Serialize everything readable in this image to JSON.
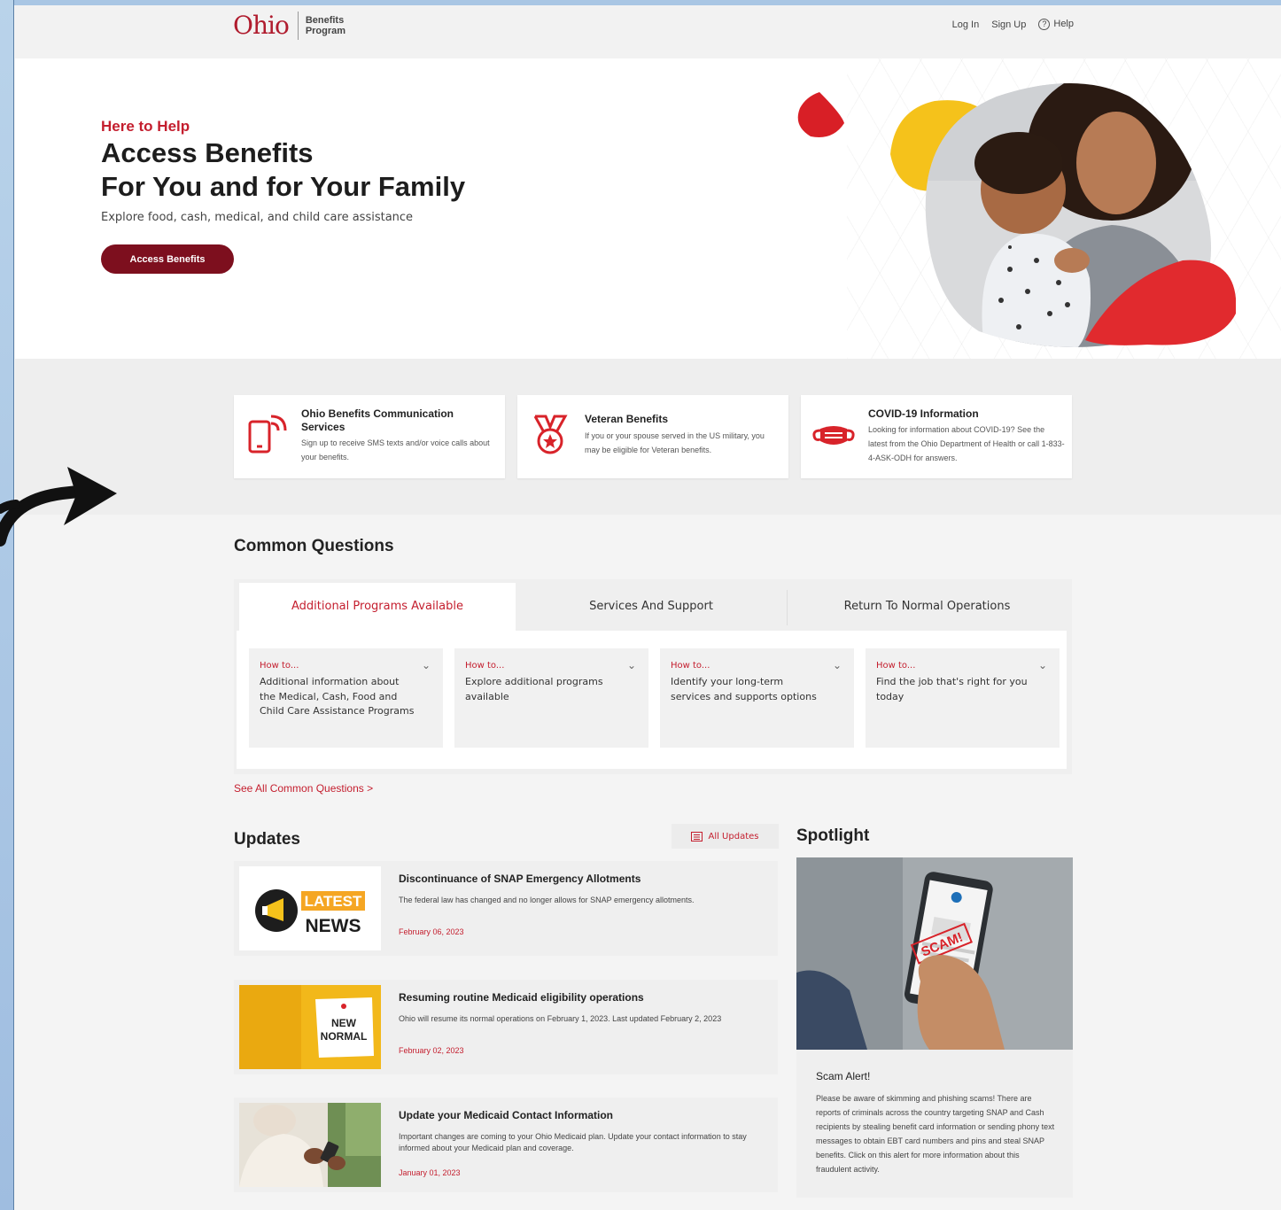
{
  "header": {
    "logo_word": "Ohio",
    "logo_sub_1": "Benefits",
    "logo_sub_2": "Program",
    "nav": {
      "login": "Log In",
      "signup": "Sign Up",
      "help": "Help"
    }
  },
  "hero": {
    "eyebrow": "Here to Help",
    "title_1": "Access Benefits",
    "title_2": "For You and for Your Family",
    "subtitle": "Explore food, cash, medical, and child care assistance",
    "button": "Access Benefits"
  },
  "info_cards": [
    {
      "title": "Ohio Benefits Communication Services",
      "desc": "Sign up to receive SMS texts and/or voice calls about your benefits.",
      "icon": "phone-signal-icon"
    },
    {
      "title": "Veteran Benefits",
      "desc": "If you or your spouse served in the US military, you may be eligible for Veteran benefits.",
      "icon": "medal-icon"
    },
    {
      "title": "COVID-19 Information",
      "desc": "Looking for information about COVID-19? See the latest from the Ohio Department of Health or call 1-833-4-ASK-ODH for answers.",
      "icon": "mask-icon"
    }
  ],
  "common_questions": {
    "title": "Common Questions",
    "tabs": [
      "Additional Programs Available",
      "Services And Support",
      "Return To Normal Operations"
    ],
    "faqs": [
      {
        "how": "How to...",
        "q": "Additional information about the Medical, Cash, Food and Child Care Assistance Programs"
      },
      {
        "how": "How to...",
        "q": "Explore additional programs available"
      },
      {
        "how": "How to...",
        "q": "Identify your long-term services and supports options"
      },
      {
        "how": "How to...",
        "q": "Find the job that's right for you today"
      }
    ],
    "see_all": "See All Common Questions >"
  },
  "updates": {
    "title": "Updates",
    "all_button": "All Updates",
    "items": [
      {
        "title": "Discontinuance of SNAP Emergency Allotments",
        "desc": "The federal law has changed and no longer allows for SNAP emergency allotments.",
        "date": "February 06, 2023",
        "thumb_text_1": "LATEST",
        "thumb_text_2": "NEWS"
      },
      {
        "title": "Resuming routine Medicaid eligibility operations",
        "desc": "Ohio will resume its normal operations on February 1, 2023. Last updated February 2, 2023",
        "date": "February 02, 2023",
        "thumb_text_1": "NEW",
        "thumb_text_2": "NORMAL"
      },
      {
        "title": "Update your Medicaid Contact Information",
        "desc": "Important changes are coming to your Ohio Medicaid plan. Update your contact information to stay informed about your Medicaid plan and coverage.",
        "date": "January 01, 2023"
      }
    ]
  },
  "spotlight": {
    "title": "Spotlight",
    "img_text": "SCAM!",
    "heading": "Scam Alert!",
    "body": "Please be aware of skimming and phishing scams! There are reports of criminals across the country targeting SNAP and Cash recipients by stealing benefit card information or sending phony text messages to obtain EBT card numbers and pins and steal SNAP benefits. Click on this alert for more information about this fraudulent activity."
  },
  "colors": {
    "brand_red": "#c41e2e",
    "brand_dark": "#7d0f1e"
  }
}
